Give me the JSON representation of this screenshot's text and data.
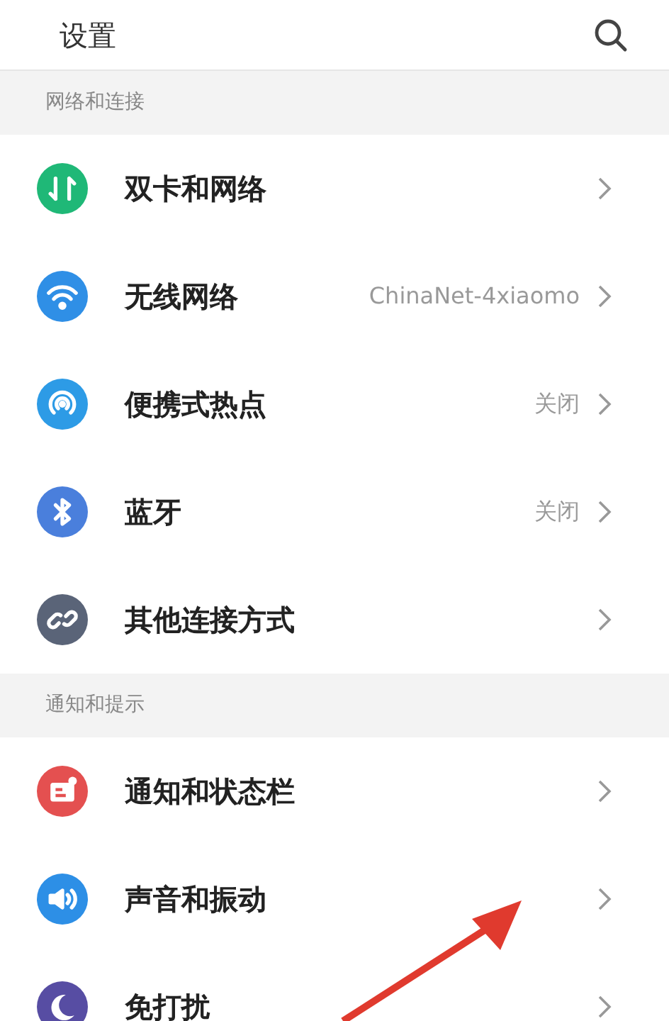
{
  "header": {
    "title": "设置"
  },
  "sections": [
    {
      "title": "网络和连接",
      "items": [
        {
          "kind": "sim",
          "color": "#1fb877",
          "label": "双卡和网络"
        },
        {
          "kind": "wifi",
          "color": "#2f8fe6",
          "label": "无线网络",
          "value": "ChinaNet-4xiaomo"
        },
        {
          "kind": "hotspot",
          "color": "#2d9be6",
          "label": "便携式热点",
          "value": "关闭"
        },
        {
          "kind": "bluetooth",
          "color": "#4a7fdc",
          "label": "蓝牙",
          "value": "关闭"
        },
        {
          "kind": "link",
          "color": "#5a6478",
          "label": "其他连接方式"
        }
      ]
    },
    {
      "title": "通知和提示",
      "items": [
        {
          "kind": "notification",
          "color": "#e45050",
          "label": "通知和状态栏"
        },
        {
          "kind": "sound",
          "color": "#2d8fe6",
          "label": "声音和振动"
        },
        {
          "kind": "moon",
          "color": "#574da3",
          "label": "免打扰"
        }
      ]
    }
  ]
}
